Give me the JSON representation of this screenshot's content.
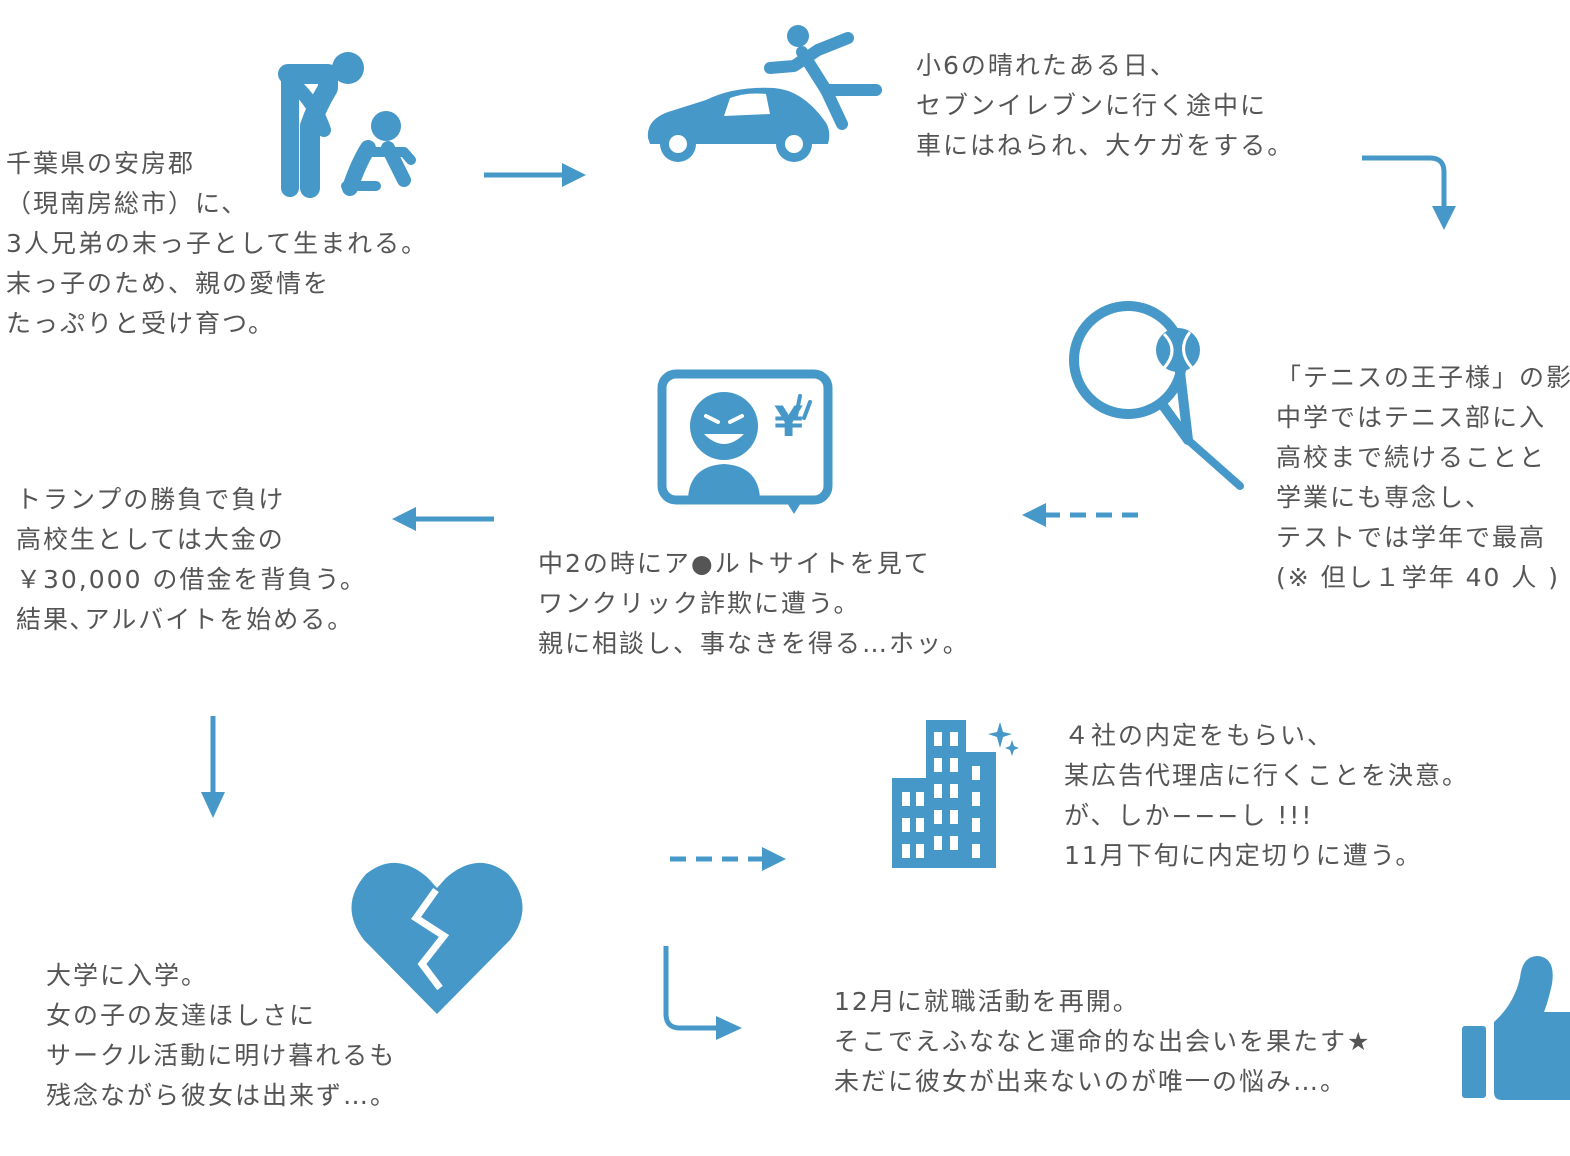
{
  "accent": "#4698C8",
  "text_color": "#555555",
  "steps": [
    {
      "id": "birth",
      "icon": "parent-child-icon",
      "lines": [
        "千葉県の安房郡",
        "（現南房総市）に、",
        "3人兄弟の末っ子として生まれる。",
        "末っ子のため、親の愛情を",
        "たっぷりと受け育つ。"
      ]
    },
    {
      "id": "accident",
      "icon": "car-accident-icon",
      "lines": [
        "小6の晴れたある日、",
        "セブンイレブンに行く途中に",
        "車にはねられ、大ケガをする。"
      ]
    },
    {
      "id": "tennis",
      "icon": "tennis-racket-icon",
      "lines": [
        "「テニスの王子様」の影",
        "中学ではテニス部に入",
        "高校まで続けることと",
        "学業にも専念し、",
        "テストでは学年で最高",
        "(※ 但し１学年 40 人 )"
      ]
    },
    {
      "id": "scam",
      "icon": "scam-monitor-icon",
      "lines": [
        "中2の時にア●ルトサイトを見て",
        "ワンクリック詐欺に遭う。",
        "親に相談し、事なきを得る…ホッ。"
      ]
    },
    {
      "id": "debt",
      "icon": "",
      "lines": [
        "トランプの勝負で負け",
        "高校生としては大金の",
        "￥30,000 の借金を背負う。",
        "結果､アルバイトを始める。"
      ]
    },
    {
      "id": "university",
      "icon": "broken-heart-icon",
      "lines": [
        "大学に入学。",
        "女の子の友達ほしさに",
        "サークル活動に明け暮れるも",
        "残念ながら彼女は出来ず…。"
      ]
    },
    {
      "id": "job-offer",
      "icon": "office-building-icon",
      "lines": [
        "４社の内定をもらい、",
        "某広告代理店に行くことを決意。",
        "が、しか−−−し !!!",
        "11月下旬に内定切りに遭う。"
      ]
    },
    {
      "id": "resume",
      "icon": "thumbs-up-icon",
      "lines": [
        "12月に就職活動を再開。",
        "そこでえふななと運命的な出会いを果たす★",
        "未だに彼女が出来ないのが唯一の悩み…。"
      ]
    }
  ]
}
